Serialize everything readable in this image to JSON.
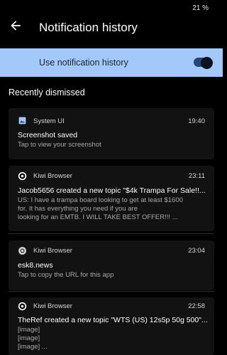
{
  "status_bar": {
    "battery": "21 %"
  },
  "app_bar": {
    "title": "Notification history"
  },
  "toggle": {
    "label": "Use notification history",
    "enabled": true
  },
  "section": {
    "title": "Recently dismissed"
  },
  "notifications": [
    {
      "app": "System UI",
      "icon": "image-icon",
      "time": "19:40",
      "title": "Screenshot saved",
      "lines": [
        "Tap to view your screenshot"
      ]
    },
    {
      "app": "Kiwi Browser",
      "icon": "kiwi-logo-icon",
      "time": "23:11",
      "title": "Jacob5656 created a new topic \"$4k Trampa For Sale!!...",
      "lines": [
        "US: I have a trampa board looking to get at least $1600",
        "for. It has everything you need if you are",
        "looking for an EMTB. I WILL TAKE BEST OFFER!!! ..."
      ]
    },
    {
      "app": "Kiwi Browser",
      "icon": "chrome-icon",
      "time": "23:04",
      "title": "esk8.news",
      "lines": [
        "Tap to copy the URL for this app"
      ]
    },
    {
      "app": "Kiwi Browser",
      "icon": "kiwi-logo-icon",
      "time": "22:58",
      "title": "TheRef created a new topic \"WTS (US) 12s5p 50g 500\"...",
      "lines": [
        "[image]",
        "[image]",
        "[image] ..."
      ]
    }
  ],
  "colors": {
    "toggle_bg": "#a3c9fb",
    "switch_track": "#26457a",
    "card_bg": "#121212"
  }
}
